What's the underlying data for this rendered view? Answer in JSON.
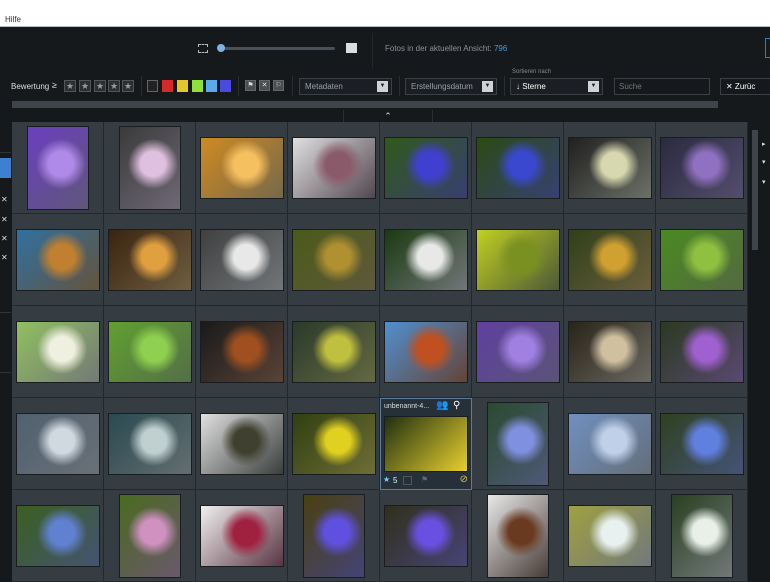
{
  "menu": {
    "help": "Hilfe"
  },
  "topbar": {
    "count_label": "Fotos in der aktuellen Ansicht:",
    "count": "796",
    "zoom_level": 0.0
  },
  "filter": {
    "rating_label": "Bewertung",
    "rating_op": "≥",
    "stars": [
      "★",
      "★",
      "★",
      "★",
      "★"
    ],
    "colors": [
      "#d42a2a",
      "#e2c72a",
      "#8fe03a",
      "#5aa9e8",
      "#4a4ae0"
    ],
    "flags": [
      "flagged",
      "rejected",
      "unflagged"
    ],
    "metadata": "Metadaten",
    "date": "Erstellungsdatum",
    "sort_label": "Sortieren nach",
    "sort_value": "↓ Sterne",
    "search_placeholder": "Suche",
    "reset": "✕ Zurüc"
  },
  "selected": {
    "name": "unbenannt-4...",
    "rating": "5"
  },
  "photos": [
    {
      "o": "portrait",
      "c": [
        "#6a3fc0",
        "#b08ae8"
      ]
    },
    {
      "o": "portrait",
      "c": [
        "#3a3a3a",
        "#e0c0e0"
      ]
    },
    {
      "o": "landscape",
      "c": [
        "#d08a20",
        "#f5c060"
      ]
    },
    {
      "o": "landscape",
      "c": [
        "#e0e0e0",
        "#8a5a6a"
      ]
    },
    {
      "o": "landscape",
      "c": [
        "#2f5a1a",
        "#4040d0"
      ]
    },
    {
      "o": "landscape",
      "c": [
        "#2a4a14",
        "#3a48d0"
      ]
    },
    {
      "o": "landscape",
      "c": [
        "#202020",
        "#d8d8b0"
      ]
    },
    {
      "o": "landscape",
      "c": [
        "#2a2a40",
        "#9070c0"
      ]
    },
    {
      "o": "landscape",
      "c": [
        "#3070a0",
        "#c08030"
      ]
    },
    {
      "o": "landscape",
      "c": [
        "#3a2410",
        "#e0a040"
      ]
    },
    {
      "o": "landscape",
      "c": [
        "#404040",
        "#e8e8e8"
      ]
    },
    {
      "o": "landscape",
      "c": [
        "#4a5a18",
        "#b09030"
      ]
    },
    {
      "o": "landscape",
      "c": [
        "#1a3a10",
        "#e8e8e8"
      ]
    },
    {
      "o": "landscape",
      "c": [
        "#c0d020",
        "#7a9020"
      ]
    },
    {
      "o": "landscape",
      "c": [
        "#30401a",
        "#d0a030"
      ]
    },
    {
      "o": "landscape",
      "c": [
        "#4a8a20",
        "#90c040"
      ]
    },
    {
      "o": "landscape",
      "c": [
        "#90c060",
        "#f0f0e0"
      ]
    },
    {
      "o": "landscape",
      "c": [
        "#60a030",
        "#90d050"
      ]
    },
    {
      "o": "landscape",
      "c": [
        "#1a1a1a",
        "#a05020"
      ]
    },
    {
      "o": "landscape",
      "c": [
        "#2a3a2a",
        "#c0c040"
      ]
    },
    {
      "o": "landscape",
      "c": [
        "#5090d0",
        "#c05020"
      ]
    },
    {
      "o": "landscape",
      "c": [
        "#6040a0",
        "#a080e0"
      ]
    },
    {
      "o": "landscape",
      "c": [
        "#2a2418",
        "#d0c0a0"
      ]
    },
    {
      "o": "landscape",
      "c": [
        "#2a3a20",
        "#a060d0"
      ]
    },
    {
      "o": "landscape",
      "c": [
        "#506070",
        "#d0d8e0"
      ]
    },
    {
      "o": "landscape",
      "c": [
        "#2a4a50",
        "#c0d0d0"
      ]
    },
    {
      "o": "landscape",
      "c": [
        "#e0e0e0",
        "#404030"
      ]
    },
    {
      "o": "landscape",
      "c": [
        "#304010",
        "#e0d020"
      ]
    },
    {
      "o": "landscape",
      "c": [
        "#203010",
        "#e8d030"
      ]
    },
    {
      "o": "portrait",
      "c": [
        "#2a4a30",
        "#8090e0"
      ]
    },
    {
      "o": "landscape",
      "c": [
        "#7090c0",
        "#c0d0e8"
      ]
    },
    {
      "o": "landscape",
      "c": [
        "#304020",
        "#6080e0"
      ]
    },
    {
      "o": "landscape",
      "c": [
        "#3a6020",
        "#6080d0"
      ]
    },
    {
      "o": "portrait",
      "c": [
        "#4a6a20",
        "#d090c0"
      ]
    },
    {
      "o": "landscape",
      "c": [
        "#f0f0f0",
        "#a02040"
      ]
    },
    {
      "o": "portrait",
      "c": [
        "#4a4010",
        "#6050e0"
      ]
    },
    {
      "o": "landscape",
      "c": [
        "#30301a",
        "#6a50e0"
      ]
    },
    {
      "o": "portrait",
      "c": [
        "#e8e8e8",
        "#6a3a20"
      ]
    },
    {
      "o": "landscape",
      "c": [
        "#a0a040",
        "#e8f0f0"
      ]
    },
    {
      "o": "portrait",
      "c": [
        "#2a4020",
        "#e8f0e8"
      ]
    }
  ]
}
